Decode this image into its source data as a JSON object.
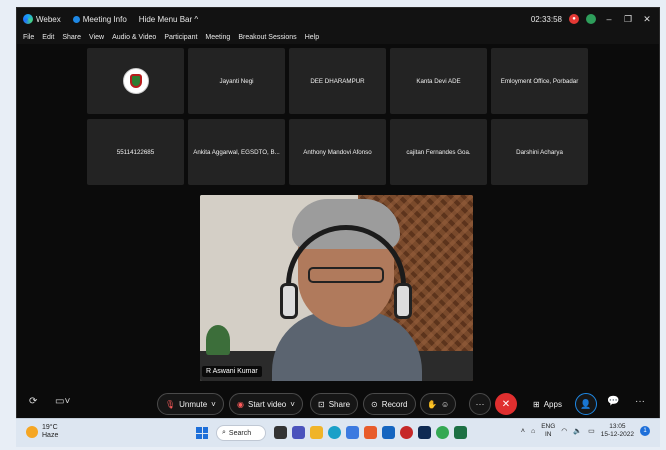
{
  "titlebar": {
    "app_name": "Webex",
    "meeting_info": "Meeting Info",
    "hide_menu_bar": "Hide Menu Bar ^",
    "time": "02:33:58"
  },
  "menu": [
    "File",
    "Edit",
    "Share",
    "View",
    "Audio & Video",
    "Participant",
    "Meeting",
    "Breakout Sessions",
    "Help"
  ],
  "participants_row1": [
    "Jayanti Negi",
    "DEE DHARAMPUR",
    "Kanta Devi ADE",
    "Emloyment Office, Porbadar"
  ],
  "participants_row2": [
    "55114122685",
    "Ankita Aggarwal, EGSDTO, B...",
    "Anthony Mandovi Afonso",
    "cajitan Fernandes Goa.",
    "Darshini Acharya"
  ],
  "active_speaker": {
    "name": "R Aswani Kumar"
  },
  "controls": {
    "unmute": "Unmute",
    "start_video": "Start video",
    "share": "Share",
    "record": "Record",
    "apps": "Apps"
  },
  "taskbar": {
    "temperature": "19°C",
    "weather": "Haze",
    "search": "Search",
    "language_top": "ENG",
    "language_bottom": "IN",
    "clock_time": "13:05",
    "clock_date": "15-12-2022",
    "notification_count": "1"
  },
  "colors": {
    "leave": "#e02f2f",
    "accent": "#1e88e5",
    "muted": "#ff5b5b"
  }
}
